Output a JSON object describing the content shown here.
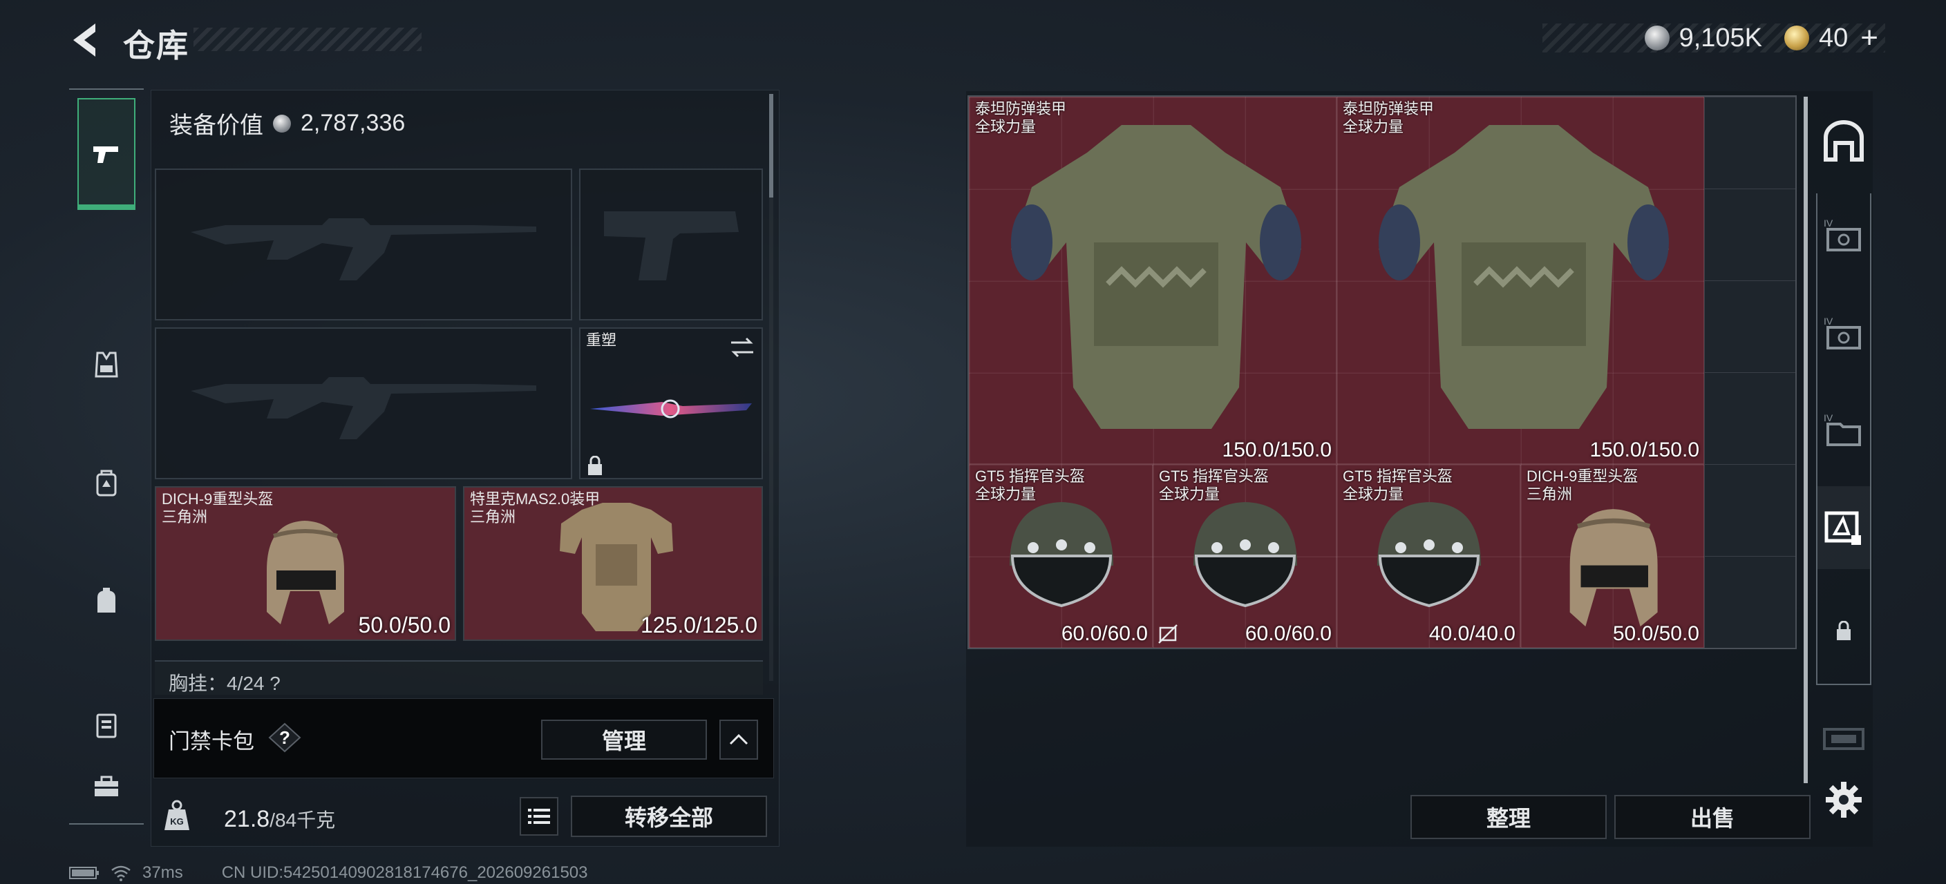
{
  "header": {
    "title": "仓库"
  },
  "currency": {
    "silver": "9,105K",
    "gold": "40"
  },
  "loadout": {
    "equipment_value_label": "装备价值",
    "equipment_value": "2,787,336",
    "melee_slot_label": "重塑",
    "helmet": {
      "name": "DICH-9重型头盔",
      "faction": "三角洲",
      "durability": "50.0/50.0"
    },
    "armor": {
      "name": "特里克MAS2.0装甲",
      "faction": "三角洲",
      "durability": "125.0/125.0"
    },
    "chest_rig_text": "胸挂：4/24  ?"
  },
  "keycard": {
    "label": "门禁卡包",
    "manage": "管理"
  },
  "bottom": {
    "weight": "21.8",
    "capacity": "/84千克",
    "transfer_all": "转移全部"
  },
  "storage": {
    "items": [
      {
        "name": "泰坦防弹装甲",
        "faction": "全球力量",
        "durability": "150.0/150.0"
      },
      {
        "name": "泰坦防弹装甲",
        "faction": "全球力量",
        "durability": "150.0/150.0"
      },
      {
        "name": "GT5 指挥官头盔",
        "faction": "全球力量",
        "durability": "60.0/60.0"
      },
      {
        "name": "GT5 指挥官头盔",
        "faction": "全球力量",
        "durability": "60.0/60.0"
      },
      {
        "name": "GT5 指挥官头盔",
        "faction": "全球力量",
        "durability": "40.0/40.0"
      },
      {
        "name": "DICH-9重型头盔",
        "faction": "三角洲",
        "durability": "50.0/50.0"
      }
    ],
    "sort": "整理",
    "sell": "出售"
  },
  "status": {
    "ping": "37ms",
    "uid": "CN UID:542501409028181746​76_202609261503"
  },
  "colors": {
    "accent": "#3fae7a",
    "item_bg": "#6e2330"
  },
  "icons": [
    "back-icon",
    "pistol-icon",
    "vest-icon",
    "backpack-icon",
    "pouch-icon",
    "case-icon",
    "toolbox-icon",
    "gear-icon",
    "lock-icon",
    "list-icon",
    "weight-icon",
    "help-icon",
    "swap-icon"
  ]
}
